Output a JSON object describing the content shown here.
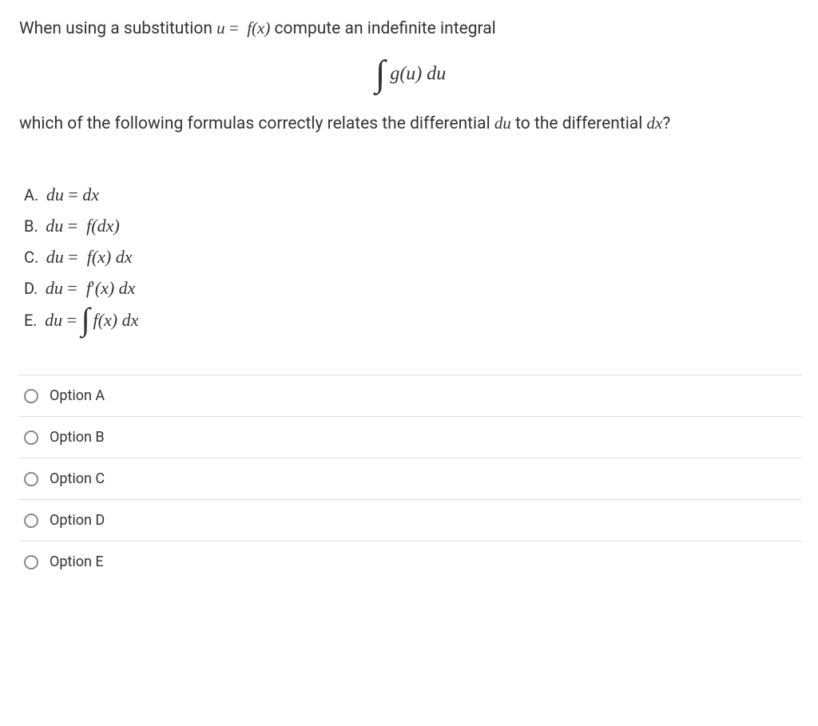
{
  "question": {
    "line1_pre": "When using a substitution ",
    "sub_expr_lhs": "u",
    "sub_expr_eq": " = ",
    "sub_expr_rhs": "f(x)",
    "line1_post": " compute an indefinite integral",
    "integral_g": "g",
    "integral_u": "(u)",
    "integral_du": " du",
    "line2": "which of the following formulas correctly relates the differential ",
    "du_word": "du",
    "line2_mid": " to the differential ",
    "dx_word": "dx",
    "line2_end": "?"
  },
  "answers": {
    "a": {
      "label": "A.",
      "lhs": "du",
      "eq": " = ",
      "rhs": "dx"
    },
    "b": {
      "label": "B.",
      "lhs": "du",
      "eq": " = ",
      "rhs_f": "f",
      "rhs_arg": "(dx)"
    },
    "c": {
      "label": "C.",
      "lhs": "du",
      "eq": " = ",
      "rhs_f": "f",
      "rhs_arg": "(x) dx"
    },
    "d": {
      "label": "D.",
      "lhs": "du",
      "eq": " = ",
      "rhs_f": "f",
      "rhs_prime": "′",
      "rhs_arg": "(x) dx"
    },
    "e": {
      "label": "E.",
      "lhs": "du",
      "eq": " = ",
      "rhs_f": "f",
      "rhs_arg": "(x) dx"
    }
  },
  "options": {
    "a": "Option A",
    "b": "Option B",
    "c": "Option C",
    "d": "Option D",
    "e": "Option E"
  }
}
